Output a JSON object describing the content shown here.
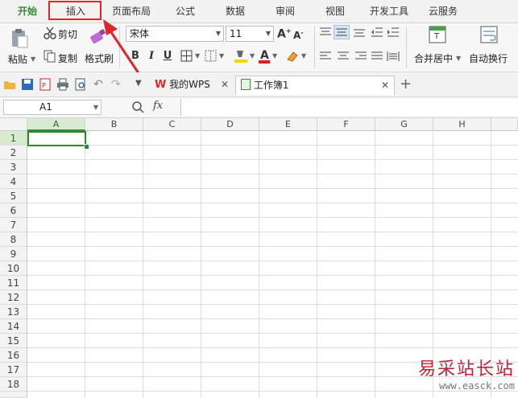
{
  "menu": {
    "tabs": [
      "开始",
      "插入",
      "页面布局",
      "公式",
      "数据",
      "审阅",
      "视图",
      "开发工具",
      "云服务"
    ],
    "active": "开始",
    "highlighted": "插入"
  },
  "ribbon": {
    "paste_label": "粘贴",
    "cut_label": "剪切",
    "copy_label": "复制",
    "format_painter_label": "格式刷",
    "font_name": "宋体",
    "font_size": "11",
    "bold": "B",
    "italic": "I",
    "underline": "U",
    "merge_label": "合并居中",
    "wrap_label": "自动换行"
  },
  "doc_tabs": [
    {
      "label": "我的WPS",
      "active": false
    },
    {
      "label": "工作簿1",
      "active": true
    }
  ],
  "formula_bar": {
    "name_box": "A1",
    "fx": "fx",
    "formula": ""
  },
  "sheet": {
    "columns": [
      "A",
      "B",
      "C",
      "D",
      "E",
      "F",
      "G",
      "H"
    ],
    "rows": [
      "1",
      "2",
      "3",
      "4",
      "5",
      "6",
      "7",
      "8",
      "9",
      "10",
      "11",
      "12",
      "13",
      "14",
      "15",
      "16",
      "17",
      "18"
    ],
    "selected_cell": "A1"
  },
  "watermark": {
    "title": "易采站长站",
    "url": "www.easck.com"
  },
  "colors": {
    "accent_green": "#2e8b2e",
    "highlight_red": "#e0262b"
  },
  "icons": [
    "paste-icon",
    "cut-icon",
    "copy-icon",
    "brush-icon",
    "open-icon",
    "save-icon",
    "pdf-icon",
    "print-icon",
    "preview-icon",
    "undo-icon",
    "redo-icon",
    "wps-logo-icon",
    "sheet-icon",
    "close-icon",
    "plus-icon",
    "search-icon"
  ]
}
